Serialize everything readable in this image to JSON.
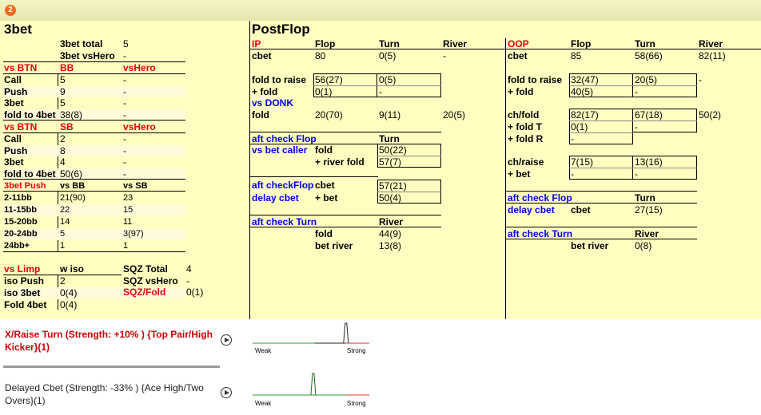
{
  "logo": {
    "text": "2"
  },
  "threebet": {
    "title": "3bet",
    "total_label": "3bet total",
    "total_value": "5",
    "vshero_label": "3bet vsHero",
    "vshero_value": "-",
    "btn": {
      "h1": "vs BTN",
      "h2": "BB",
      "h3": "vsHero",
      "rows": [
        [
          "Call",
          "5",
          "-"
        ],
        [
          "Push",
          "9",
          "-"
        ],
        [
          "3bet",
          "5",
          "-"
        ],
        [
          "fold to 4bet",
          "38(8)",
          "-"
        ]
      ]
    },
    "sb": {
      "h1": "vs BTN",
      "h2": "SB",
      "h3": "vsHero",
      "rows": [
        [
          "Call",
          "2",
          "-"
        ],
        [
          "Push",
          "8",
          "-"
        ],
        [
          "3bet",
          "4",
          "-"
        ],
        [
          "fold to 4bet",
          "50(6)",
          "-"
        ]
      ]
    },
    "push": {
      "h1": "3bet Push",
      "h2": "vs BB",
      "h3": "vs SB",
      "rows": [
        [
          "2-11bb",
          "21(90)",
          "23"
        ],
        [
          "11-15bb",
          "22",
          "15"
        ],
        [
          "15-20bb",
          "14",
          "11"
        ],
        [
          "20-24bb",
          "5",
          "3(97)"
        ],
        [
          "24bb+",
          "1",
          "1"
        ]
      ]
    },
    "limp": {
      "h1": "vs Limp",
      "h2": "w iso",
      "rows": [
        [
          "iso Push",
          "2"
        ],
        [
          "iso 3bet",
          "0(4)"
        ],
        [
          "Fold 4bet",
          "0(4)"
        ]
      ]
    },
    "sqz": {
      "total_label": "SQZ Total",
      "total_value": "4",
      "vshero_label": "SQZ vsHero",
      "vshero_value": "-",
      "fold_label": "SQZ/Fold",
      "fold_value": "0(1)"
    }
  },
  "postflop": {
    "title": "PostFlop",
    "ip": {
      "h": [
        "IP",
        "Flop",
        "Turn",
        "River"
      ],
      "cbet": [
        "cbet",
        "80",
        "0(5)",
        "-"
      ],
      "ftr_label1": "fold to raise",
      "ftr_label2": "+ fold",
      "ftr_flop1": "56(27)",
      "ftr_flop2": "0(1)",
      "ftr_turn1": "0(5)",
      "ftr_turn2": "-",
      "vs_donk": "vs DONK",
      "fold": [
        "fold",
        "20(70)",
        "9(11)",
        "20(5)"
      ],
      "acf": {
        "title": "aft check Flop",
        "col": "Turn",
        "vbc": "vs bet caller",
        "fold_label": "fold",
        "fold_value": "50(22)",
        "rf_label": "+ river fold",
        "rf_value": "57(7)"
      },
      "acf2": {
        "title": "aft checkFlop",
        "delay": "delay cbet",
        "cbet_label": "cbet",
        "cbet_value": "57(21)",
        "bet_label": "+ bet",
        "bet_value": "50(4)"
      },
      "act": {
        "title": "aft check Turn",
        "col": "River",
        "fold_label": "fold",
        "fold_value": "44(9)",
        "br_label": "bet river",
        "br_value": "13(8)"
      }
    },
    "oop": {
      "h": [
        "OOP",
        "Flop",
        "Turn",
        "River"
      ],
      "cbet": [
        "cbet",
        "85",
        "58(66)",
        "82(11)"
      ],
      "ftr_label1": "fold to raise",
      "ftr_label2": "+ fold",
      "ftr_flop1": "32(47)",
      "ftr_flop2": "40(5)",
      "ftr_turn1": "20(5)",
      "ftr_turn2": "-",
      "ftr_river": "-",
      "chf_label1": "ch/fold",
      "chf_label2": "+ fold T",
      "chf_label3": "+ fold R",
      "chf_flop1": "82(17)",
      "chf_flop2": "0(1)",
      "chf_flop3": "-",
      "chf_turn1": "67(18)",
      "chf_turn2": "-",
      "chf_river": "50(2)",
      "chr_label1": "ch/raise",
      "chr_label2": "+ bet",
      "chr_flop1": "7(15)",
      "chr_flop2": "-",
      "chr_turn1": "13(16)",
      "chr_turn2": "-",
      "acf": {
        "title": "aft check Flop",
        "col": "Turn",
        "delay": "delay cbet",
        "cbet_label": "cbet",
        "cbet_value": "27(15)"
      },
      "act": {
        "title": "aft check Turn",
        "col": "River",
        "br_label": "bet river",
        "br_value": "0(8)"
      }
    }
  },
  "hands": [
    {
      "text": "X/Raise Turn (Strength: +10% ) {Top Pair/High Kicker}(1)",
      "weak": "Weak",
      "strong": "Strong",
      "color": "#cc0000",
      "peak": 0.8
    },
    {
      "text": "Delayed Cbet (Strength: -33% ) {Ace High/Two Overs}(1)",
      "weak": "Weak",
      "strong": "Strong",
      "color": "#222222",
      "peak": 0.52
    }
  ]
}
